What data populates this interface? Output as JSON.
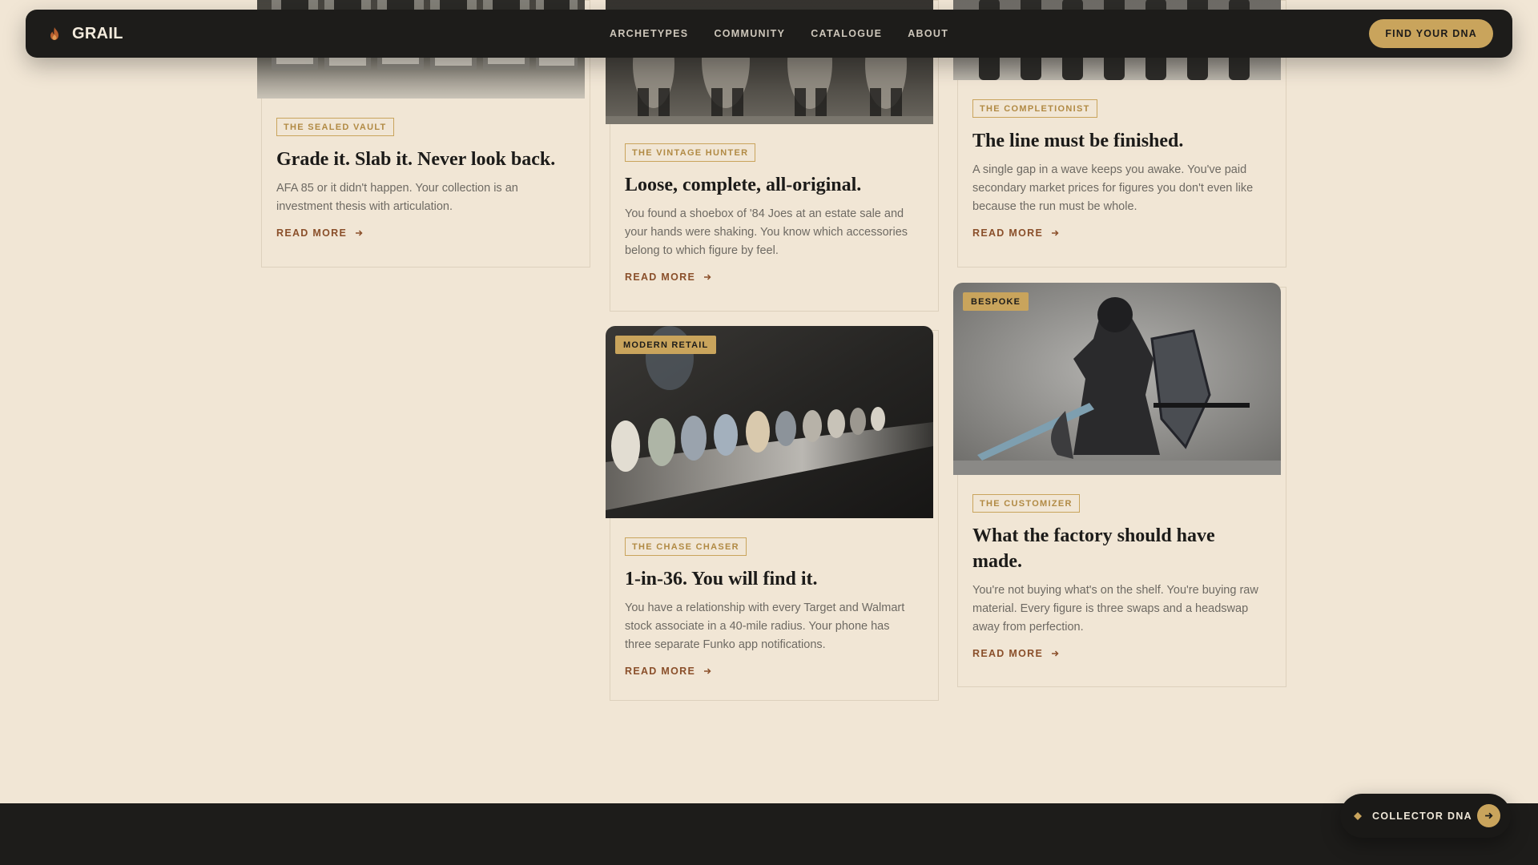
{
  "nav": {
    "brand": "GRAIL",
    "links": [
      "ARCHETYPES",
      "COMMUNITY",
      "CATALOGUE",
      "ABOUT"
    ],
    "cta": "FIND YOUR DNA"
  },
  "cards": [
    {
      "tag": "THE SEALED VAULT",
      "title": "Grade it. Slab it. Never look back.",
      "desc": "AFA 85 or it didn't happen. Your collection is an investment thesis with articulation.",
      "link": "READ MORE"
    },
    {
      "tag": "THE VINTAGE HUNTER",
      "title": "Loose, complete, all-original.",
      "desc": "You found a shoebox of '84 Joes at an estate sale and your hands were shaking. You know which accessories belong to which figure by feel.",
      "link": "READ MORE"
    },
    {
      "tag": "THE COMPLETIONIST",
      "title": "The line must be finished.",
      "desc": "A single gap in a wave keeps you awake. You've paid secondary market prices for figures you don't even like because the run must be whole.",
      "link": "READ MORE"
    },
    {
      "badge": "MODERN RETAIL",
      "tag": "THE CHASE CHASER",
      "title": "1-in-36. You will find it.",
      "desc": "You have a relationship with every Target and Walmart stock associate in a 40-mile radius. Your phone has three separate Funko app notifications.",
      "link": "READ MORE"
    },
    {
      "badge": "BESPOKE",
      "tag": "THE CUSTOMIZER",
      "title": "What the factory should have made.",
      "desc": "You're not buying what's on the shelf. You're buying raw material. Every figure is three swaps and a headswap away from perfection.",
      "link": "READ MORE"
    }
  ],
  "floating": {
    "label": "COLLECTOR DNA"
  },
  "colors": {
    "accent": "#c9a45c",
    "dark": "#1d1c1a",
    "background": "#f1e6d5",
    "link": "#8a4f2a"
  }
}
